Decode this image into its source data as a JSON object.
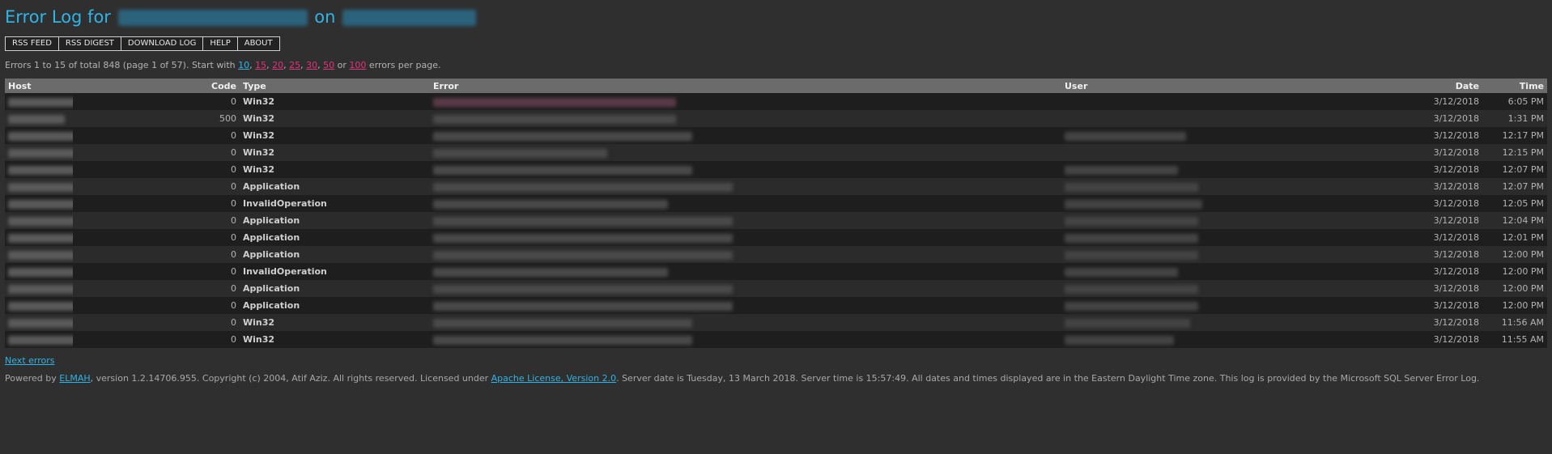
{
  "header": {
    "title_prefix": "Error Log for",
    "title_mid": "on"
  },
  "toolbar": {
    "rss_feed": "RSS FEED",
    "rss_digest": "RSS DIGEST",
    "download_log": "DOWNLOAD LOG",
    "help": "HELP",
    "about": "ABOUT"
  },
  "summary": {
    "prefix": "Errors 1 to 15 of total 848 (page 1 of 57). Start with",
    "sizes": [
      "10",
      "15",
      "20",
      "25",
      "30",
      "50"
    ],
    "or": "or",
    "last_size": "100",
    "suffix": "errors per page."
  },
  "table": {
    "headers": {
      "host": "Host",
      "code": "Code",
      "type": "Type",
      "error": "Error",
      "user": "User",
      "date": "Date",
      "time": "Time"
    },
    "rows": [
      {
        "code": "0",
        "type": "Win32",
        "date": "3/12/2018",
        "time": "6:05 PM"
      },
      {
        "code": "500",
        "type": "Win32",
        "date": "3/12/2018",
        "time": "1:31 PM"
      },
      {
        "code": "0",
        "type": "Win32",
        "date": "3/12/2018",
        "time": "12:17 PM"
      },
      {
        "code": "0",
        "type": "Win32",
        "date": "3/12/2018",
        "time": "12:15 PM"
      },
      {
        "code": "0",
        "type": "Win32",
        "date": "3/12/2018",
        "time": "12:07 PM"
      },
      {
        "code": "0",
        "type": "Application",
        "date": "3/12/2018",
        "time": "12:07 PM"
      },
      {
        "code": "0",
        "type": "InvalidOperation",
        "date": "3/12/2018",
        "time": "12:05 PM"
      },
      {
        "code": "0",
        "type": "Application",
        "date": "3/12/2018",
        "time": "12:04 PM"
      },
      {
        "code": "0",
        "type": "Application",
        "date": "3/12/2018",
        "time": "12:01 PM"
      },
      {
        "code": "0",
        "type": "Application",
        "date": "3/12/2018",
        "time": "12:00 PM"
      },
      {
        "code": "0",
        "type": "InvalidOperation",
        "date": "3/12/2018",
        "time": "12:00 PM"
      },
      {
        "code": "0",
        "type": "Application",
        "date": "3/12/2018",
        "time": "12:00 PM"
      },
      {
        "code": "0",
        "type": "Application",
        "date": "3/12/2018",
        "time": "12:00 PM"
      },
      {
        "code": "0",
        "type": "Win32",
        "date": "3/12/2018",
        "time": "11:56 AM"
      },
      {
        "code": "0",
        "type": "Win32",
        "date": "3/12/2018",
        "time": "11:55 AM"
      }
    ]
  },
  "next_link": "Next errors",
  "footer": {
    "powered_by": "Powered by",
    "elmah": "ELMAH",
    "middle": ", version 1.2.14706.955. Copyright (c) 2004, Atif Aziz. All rights reserved. Licensed under",
    "license": "Apache License, Version 2.0",
    "end": ". Server date is Tuesday, 13 March 2018. Server time is 15:57:49. All dates and times displayed are in the Eastern Daylight Time zone. This log is provided by the Microsoft SQL Server Error Log."
  },
  "colors": {
    "background": "#2f2f2f",
    "title": "#2fb4e8",
    "link_pink": "#e0337a",
    "header_row": "#6b6b6b"
  }
}
